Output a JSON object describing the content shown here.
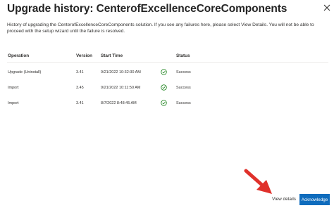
{
  "dialog": {
    "title": "Upgrade history: CenterofExcellenceCoreComponents",
    "description": "History of upgrading the CenterofExcellenceCoreComponents solution. If you see any failures here, please select View Details. You will not be able to proceed with the setup wizard until the failure is resolved."
  },
  "table": {
    "columns": [
      "Operation",
      "Version",
      "Start Time",
      "Status"
    ],
    "rows": [
      {
        "operation": "Upgrade (Uninstall)",
        "version": "3.41",
        "start_time": "9/21/2022 10:32:30 AM",
        "status_icon": "check-circle-icon",
        "status": "Success"
      },
      {
        "operation": "Import",
        "version": "3.45",
        "start_time": "9/21/2022 10:11:50 AM",
        "status_icon": "check-circle-icon",
        "status": "Success"
      },
      {
        "operation": "Import",
        "version": "3.41",
        "start_time": "8/7/2022 8:48:45 AM",
        "status_icon": "check-circle-icon",
        "status": "Success"
      }
    ]
  },
  "footer": {
    "view_details_label": "View details",
    "acknowledge_label": "Acknowledge"
  },
  "colors": {
    "accent": "#0f6cbd",
    "success": "#107c10",
    "annotation_arrow": "#e0312b"
  }
}
